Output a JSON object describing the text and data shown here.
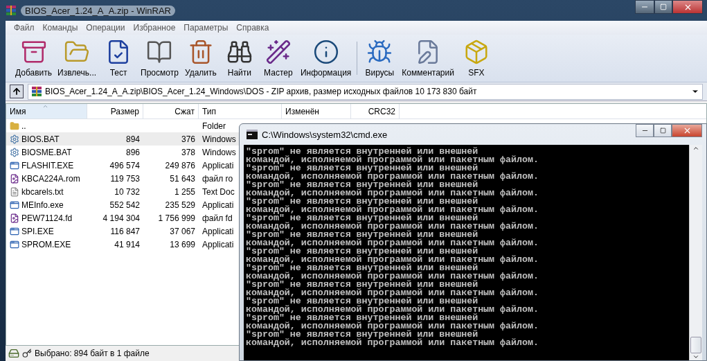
{
  "winrar": {
    "title": "BIOS_Acer_1.24_A_A.zip - WinRAR",
    "menu": [
      "Файл",
      "Команды",
      "Операции",
      "Избранное",
      "Параметры",
      "Справка"
    ],
    "toolbar_groups": [
      {
        "buttons": [
          "Добавить",
          "Извлечь...",
          "Тест",
          "Просмотр",
          "Удалить",
          "Найти",
          "Мастер",
          "Информация"
        ]
      },
      {
        "buttons": [
          "Вирусы",
          "Комментарий",
          "SFX"
        ]
      }
    ],
    "address": {
      "path": "BIOS_Acer_1.24_A_A.zip\\BIOS_Acer_1.24_Windows\\DOS - ZIP архив, размер исходных файлов 10 173 830 байт"
    },
    "table": {
      "columns": [
        "Имя",
        "Размер",
        "Сжат",
        "Тип",
        "Изменён",
        "CRC32"
      ],
      "rows": [
        {
          "kind": "folder",
          "name": "..",
          "size": "",
          "packed": "",
          "type": "Folder",
          "selected": false
        },
        {
          "kind": "bat",
          "name": "BIOS.BAT",
          "size": "894",
          "packed": "376",
          "type": "Windows",
          "selected": true
        },
        {
          "kind": "bat",
          "name": "BIOSME.BAT",
          "size": "896",
          "packed": "378",
          "type": "Windows",
          "selected": false
        },
        {
          "kind": "exe",
          "name": "FLASHIT.EXE",
          "size": "496 574",
          "packed": "249 876",
          "type": "Applicati",
          "selected": false
        },
        {
          "kind": "rom",
          "name": "KBCA224A.rom",
          "size": "119 753",
          "packed": "51 643",
          "type": "файл ro",
          "selected": false
        },
        {
          "kind": "txt",
          "name": "kbcarels.txt",
          "size": "10 732",
          "packed": "1 255",
          "type": "Text Doc",
          "selected": false
        },
        {
          "kind": "exe",
          "name": "MEInfo.exe",
          "size": "552 542",
          "packed": "235 529",
          "type": "Applicati",
          "selected": false
        },
        {
          "kind": "rom",
          "name": "PEW71124.fd",
          "size": "4 194 304",
          "packed": "1 756 999",
          "type": "файл fd",
          "selected": false
        },
        {
          "kind": "exe",
          "name": "SPI.EXE",
          "size": "116 847",
          "packed": "37 067",
          "type": "Applicati",
          "selected": false
        },
        {
          "kind": "exe",
          "name": "SPROM.EXE",
          "size": "41 914",
          "packed": "13 699",
          "type": "Applicati",
          "selected": false
        }
      ]
    },
    "status_bar": "Выбрано: 894 байт в 1 файле"
  },
  "console": {
    "title": "C:\\Windows\\system32\\cmd.exe",
    "lines": [
      "\"sprom\" не является внутренней или внешней",
      "командой, исполняемой программой или пакетным файлом.",
      "\"sprom\" не является внутренней или внешней",
      "командой, исполняемой программой или пакетным файлом.",
      "\"sprom\" не является внутренней или внешней",
      "командой, исполняемой программой или пакетным файлом.",
      "\"sprom\" не является внутренней или внешней",
      "командой, исполняемой программой или пакетным файлом.",
      "\"sprom\" не является внутренней или внешней",
      "командой, исполняемой программой или пакетным файлом.",
      "\"sprom\" не является внутренней или внешней",
      "командой, исполняемой программой или пакетным файлом.",
      "\"sprom\" не является внутренней или внешней",
      "командой, исполняемой программой или пакетным файлом.",
      "\"sprom\" не является внутренней или внешней",
      "командой, исполняемой программой или пакетным файлом.",
      "\"sprom\" не является внутренней или внешней",
      "командой, исполняемой программой или пакетным файлом.",
      "\"sprom\" не является внутренней или внешней",
      "командой, исполняемой программой или пакетным файлом.",
      "\"sprom\" не является внутренней или внешней",
      "командой, исполняемой программой или пакетным файлом.",
      "\"sprom\" не является внутренней или внешней",
      "командой, исполняемой программой или пакетным файлом."
    ]
  }
}
